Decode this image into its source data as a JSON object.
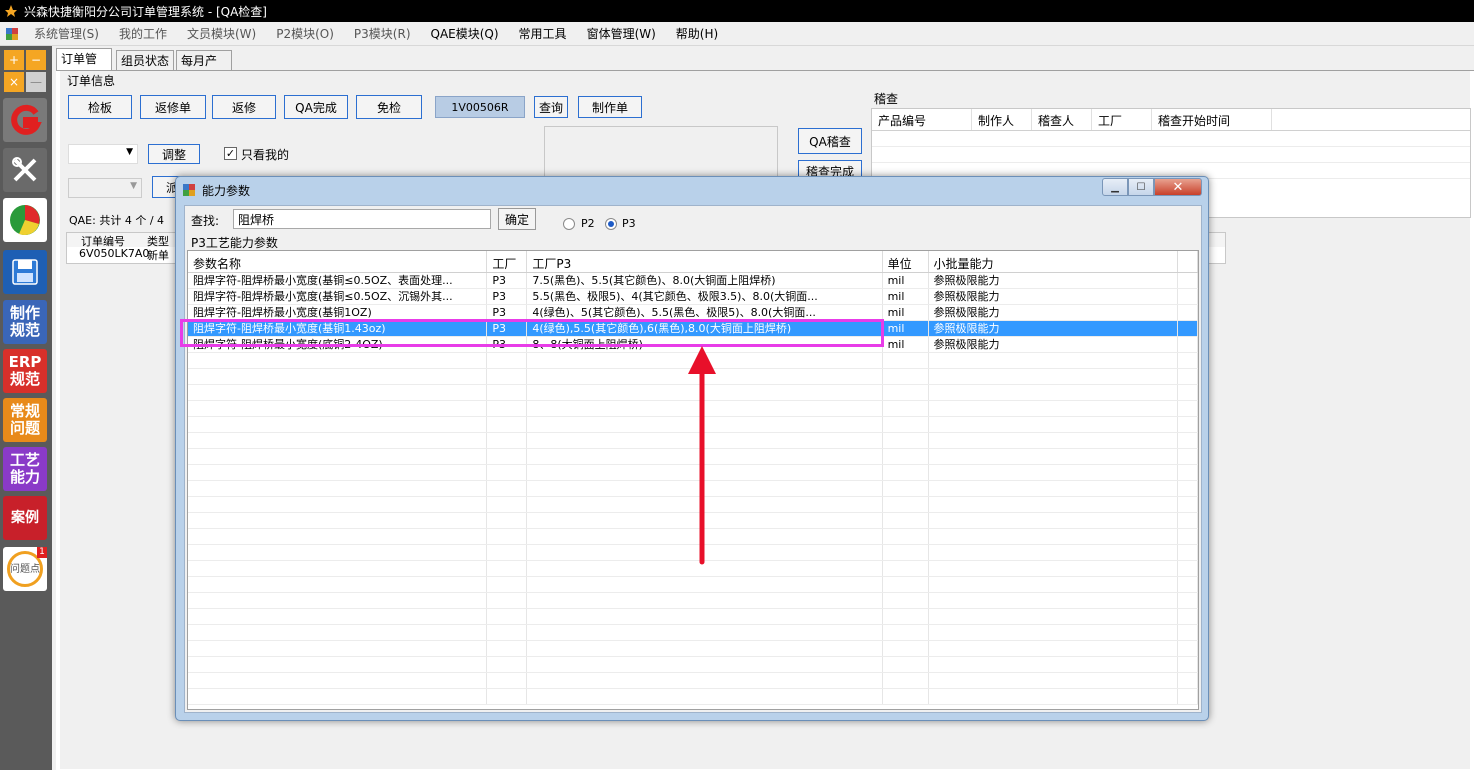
{
  "window": {
    "title": "兴森快捷衡阳分公司订单管理系统 - [QA检查]"
  },
  "menu": [
    "系统管理(S)",
    "我的工作",
    "文员模块(W)",
    "P2模块(O)",
    "P3模块(R)",
    "QAE模块(Q)",
    "常用工具",
    "窗体管理(W)",
    "帮助(H)"
  ],
  "sidebar": {
    "items": [
      {
        "line1": "制作",
        "line2": "规范"
      },
      {
        "line1": "ERP",
        "line2": "规范"
      },
      {
        "line1": "常规",
        "line2": "问题"
      },
      {
        "line1": "工艺",
        "line2": "能力"
      },
      {
        "line1": "案例",
        "line2": ""
      },
      {
        "line1": "问题点",
        "line2": "",
        "badge": "1"
      }
    ]
  },
  "tabs": [
    "订单管理",
    "组员状态",
    "每月产量"
  ],
  "order_info": {
    "label": "订单信息",
    "buttons": [
      "检板",
      "返修单",
      "返修",
      "QA完成",
      "免检"
    ],
    "order_no": "1V00506R",
    "query": "查询",
    "make_order": "制作单",
    "adjust": "调整",
    "only_mine": "只看我的",
    "dispatch": "派",
    "qa_check": "QA稽查",
    "check_done": "稽查完成",
    "count_text": "QAE: 共计 4 个 / 4",
    "list_headers": [
      "订单编号",
      "类型"
    ],
    "list_row": {
      "no": "6V050LK7A0",
      "type": "新单"
    }
  },
  "audit": {
    "label": "稽查",
    "headers": [
      "产品编号",
      "制作人",
      "稽查人",
      "工厂",
      "稽查开始时间"
    ]
  },
  "dialog": {
    "title": "能力参数",
    "search_label": "查找:",
    "search_value": "阻焊桥",
    "confirm": "确定",
    "radio_p2": "P2",
    "radio_p3": "P3",
    "section": "P3工艺能力参数",
    "headers": [
      "参数名称",
      "工厂",
      "工厂P3",
      "单位",
      "小批量能力"
    ],
    "rows": [
      {
        "name": "阻焊字符-阻焊桥最小宽度(基铜≤0.5OZ、表面处理...",
        "plant": "P3",
        "p3": "7.5(黑色)、5.5(其它颜色)、8.0(大铜面上阻焊桥)",
        "unit": "mil",
        "cap": "参照极限能力"
      },
      {
        "name": "阻焊字符-阻焊桥最小宽度(基铜≤0.5OZ、沉锡外其...",
        "plant": "P3",
        "p3": "5.5(黑色、极限5)、4(其它颜色、极限3.5)、8.0(大铜面...",
        "unit": "mil",
        "cap": "参照极限能力"
      },
      {
        "name": "阻焊字符-阻焊桥最小宽度(基铜1OZ)",
        "plant": "P3",
        "p3": "4(绿色)、5(其它颜色)、5.5(黑色、极限5)、8.0(大铜面...",
        "unit": "mil",
        "cap": "参照极限能力"
      },
      {
        "name": "阻焊字符-阻焊桥最小宽度(基铜1.43oz)",
        "plant": "P3",
        "p3": "4(绿色),5.5(其它颜色),6(黑色),8.0(大铜面上阻焊桥)",
        "unit": "mil",
        "cap": "参照极限能力"
      },
      {
        "name": "阻焊字符-阻焊桥最小宽度(底铜2-4OZ)",
        "plant": "P3",
        "p3": "8、8(大铜面上阻焊桥)",
        "unit": "mil",
        "cap": "参照极限能力"
      }
    ]
  },
  "colors": {
    "selection": "#3399ff",
    "highlight": "#e83ce8",
    "arrow": "#e8102a"
  }
}
